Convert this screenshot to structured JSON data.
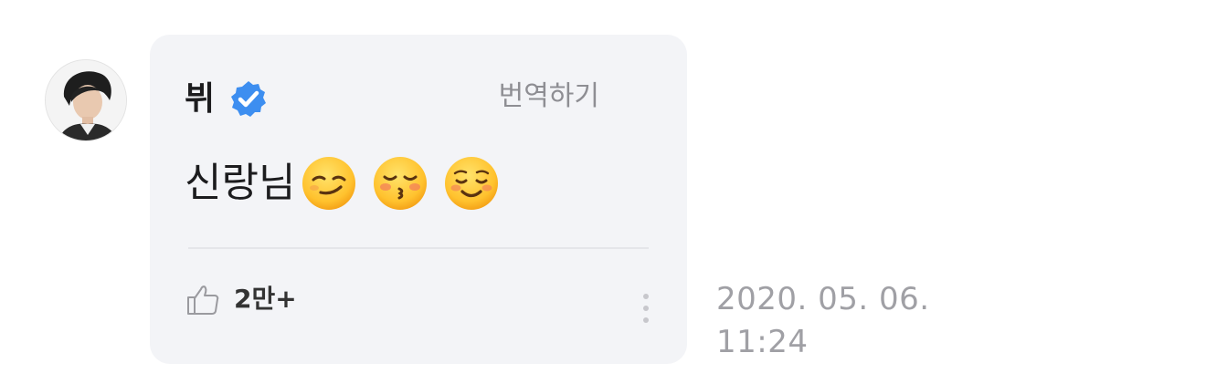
{
  "comment": {
    "author_name": "뷔",
    "verified_icon": "verified-badge-icon",
    "translate_label": "번역하기",
    "message_text": "신랑님",
    "emojis": [
      "smirking-face-icon",
      "kissing-face-icon",
      "smiling-face-icon"
    ],
    "likes_count": "2만+",
    "like_icon": "thumbs-up-icon",
    "more_icon": "more-vertical-icon",
    "timestamp_date": "2020. 05. 06.",
    "timestamp_time": "11:24"
  },
  "colors": {
    "bubble_background": "#f3f4f7",
    "verified_blue": "#3d8ef0",
    "muted_text": "#8e8e93",
    "timestamp_text": "#a0a0a5"
  }
}
